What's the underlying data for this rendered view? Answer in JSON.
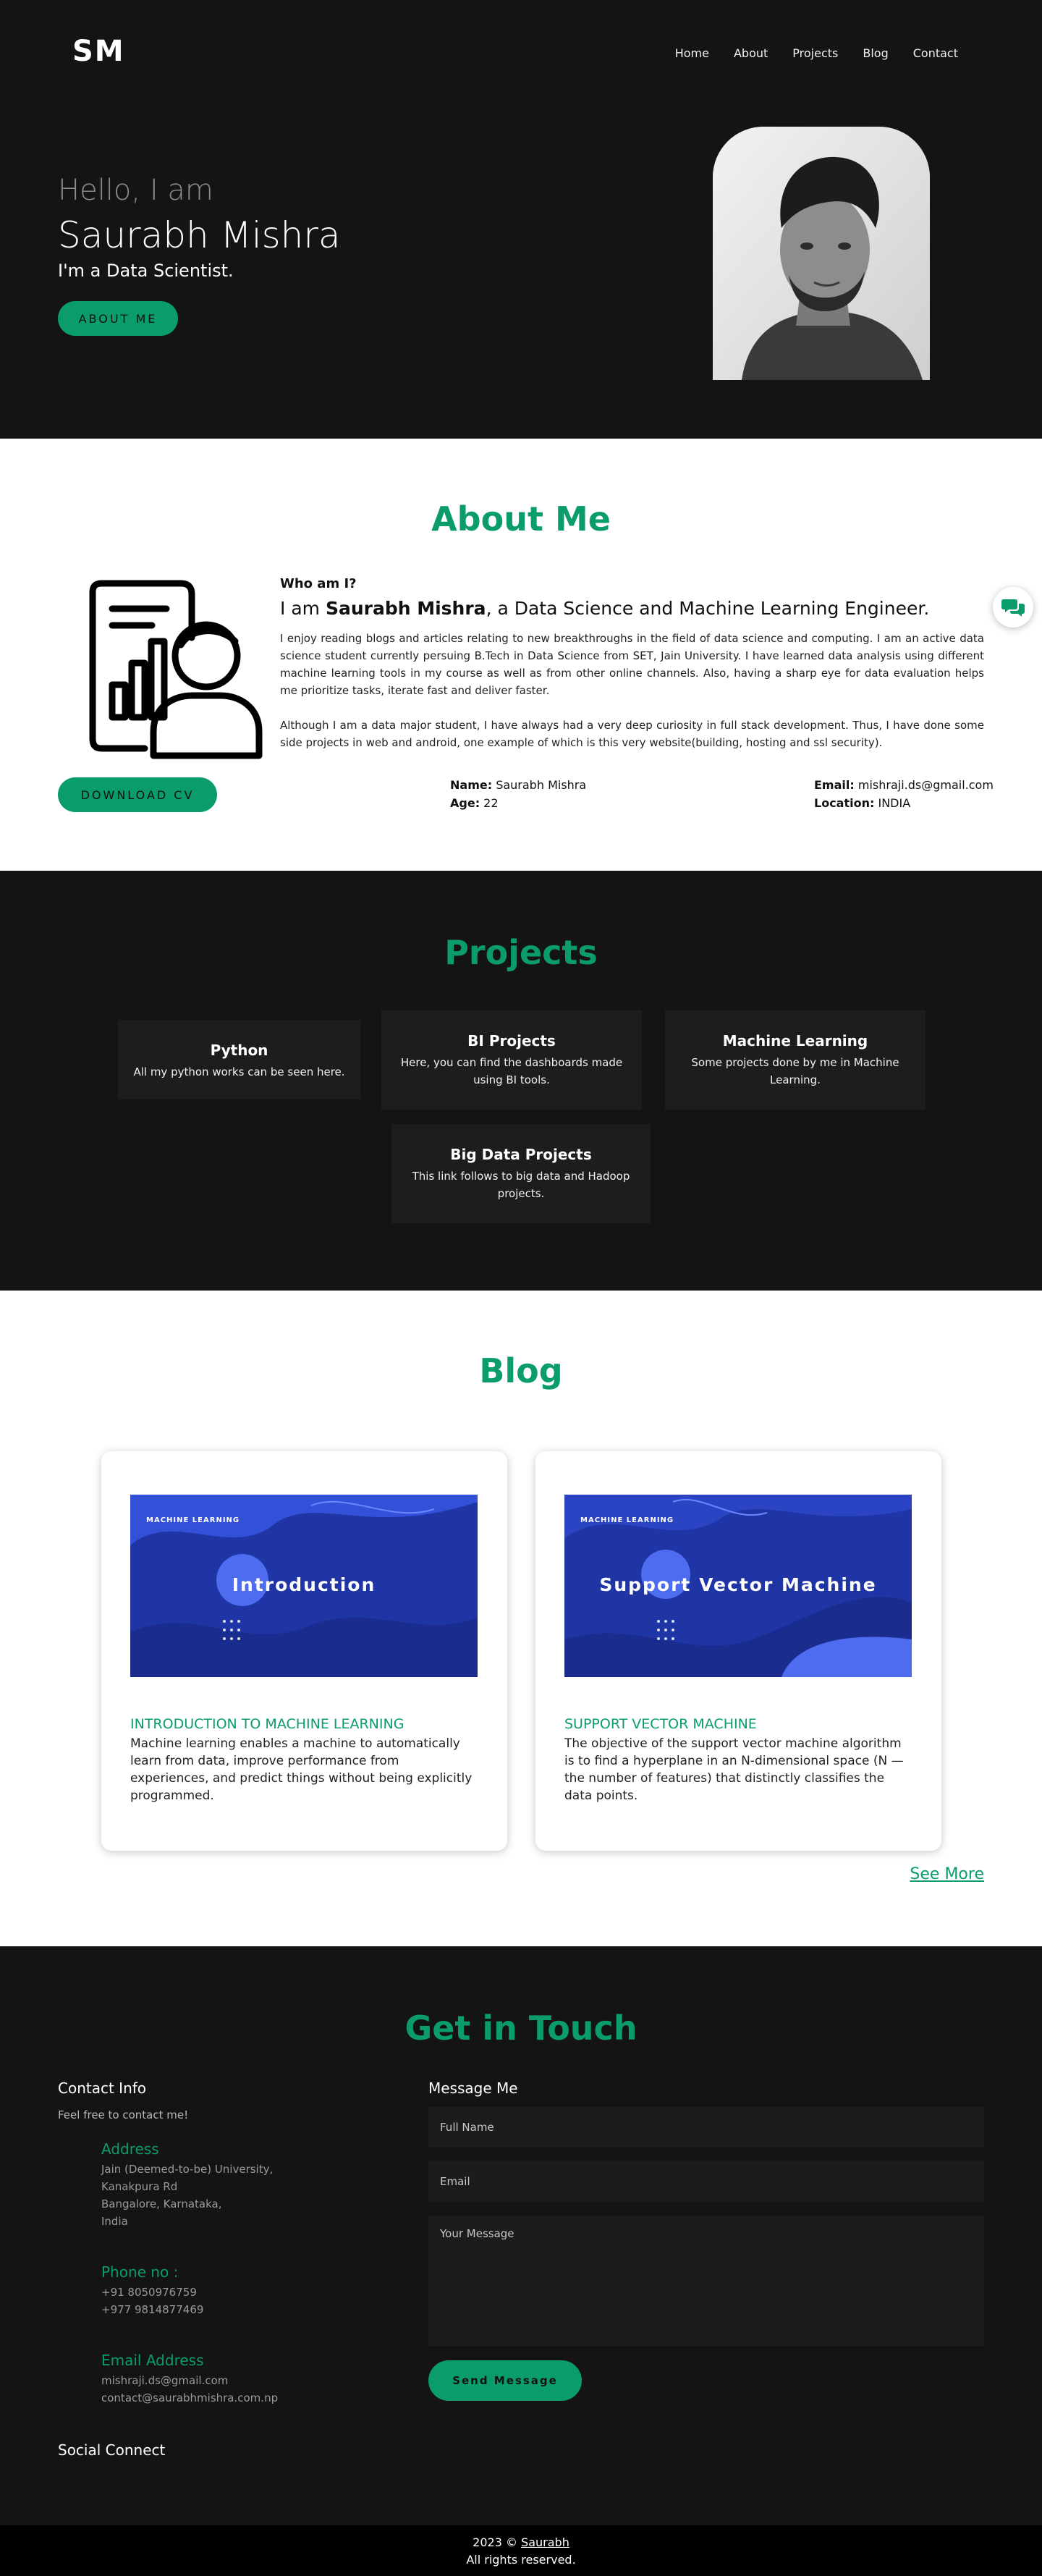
{
  "header": {
    "logo": "SM",
    "nav": [
      "Home",
      "About",
      "Projects",
      "Blog",
      "Contact"
    ]
  },
  "hero": {
    "hello": "Hello, I am",
    "name": "Saurabh Mishra",
    "role": "I'm a Data Scientist.",
    "button": "ABOUT ME"
  },
  "about": {
    "title": "About Me",
    "who": "Who am I?",
    "iam_prefix": "I am ",
    "iam_name": "Saurabh Mishra",
    "iam_suffix": ", a Data Science and Machine Learning Engineer.",
    "p1": "I enjoy reading blogs and articles relating to new breakthroughs in the field of data science and computing. I am an active data science student currently persuing B.Tech in Data Science from SET, Jain University. I have learned data analysis using different machine learning tools in my course as well as from other online channels. Also, having a sharp eye for data evaluation helps me prioritize tasks, iterate fast and deliver faster.",
    "p2": "Although I am a data major student, I have always had a very deep curiosity in full stack development. Thus, I have done some side projects in web and android, one example of which is this very website(building, hosting and ssl security).",
    "cv_button": "DOWNLOAD CV",
    "name_label": "Name:",
    "name_value": " Saurabh Mishra",
    "age_label": "Age:",
    "age_value": " 22",
    "email_label": "Email:",
    "email_value": " mishraji.ds@gmail.com",
    "location_label": "Location:",
    "location_value": " INDIA"
  },
  "projects": {
    "title": "Projects",
    "items": [
      {
        "title": "Python",
        "desc": "All my python works can be seen here."
      },
      {
        "title": "BI Projects",
        "desc": "Here, you can find the dashboards made using BI tools."
      },
      {
        "title": "Machine Learning",
        "desc": "Some projects done by me in Machine Learning."
      },
      {
        "title": "Big Data Projects",
        "desc": "This link follows to big data and Hadoop projects."
      }
    ]
  },
  "blog": {
    "title": "Blog",
    "posts": [
      {
        "image_tag": "MACHINE LEARNING",
        "image_title": "Introduction",
        "title": "INTRODUCTION TO MACHINE LEARNING",
        "text": "Machine learning enables a machine to automatically learn from data, improve performance from experiences, and predict things without being explicitly programmed."
      },
      {
        "image_tag": "MACHINE LEARNING",
        "image_title": "Support Vector Machine",
        "title": "SUPPORT VECTOR MACHINE",
        "text": "The objective of the support vector machine algorithm is to find a hyperplane in an N-dimensional space (N — the number of features) that distinctly classifies the data points."
      }
    ],
    "see_more": "See More"
  },
  "contact": {
    "title": "Get in Touch",
    "info_title": "Contact Info",
    "info_sub": "Feel free to contact me!",
    "address_head": "Address",
    "address_lines": [
      "Jain (Deemed-to-be) University,",
      "Kanakpura Rd",
      "Bangalore, Karnataka,",
      "India"
    ],
    "phone_head": "Phone no :",
    "phone_lines": [
      "+91 8050976759",
      "+977 9814877469"
    ],
    "email_head": "Email Address",
    "email_lines": [
      "mishraji.ds@gmail.com",
      "contact@saurabhmishra.com.np"
    ],
    "social": "Social Connect",
    "form_title": "Message Me",
    "ph_name": "Full Name",
    "ph_email": "Email",
    "ph_message": "Your Message",
    "send": "Send Message"
  },
  "footer": {
    "line1_prefix": "2023 © ",
    "line1_link": "Saurabh",
    "line2": "All rights reserved."
  },
  "colors": {
    "accent": "#0b9c6b",
    "dark_bg": "#141414",
    "card_bg": "#1d1d1d",
    "blog_image_bg": "#1f35a6"
  },
  "icons": [
    "chat-icon",
    "analytics-person-icon"
  ]
}
